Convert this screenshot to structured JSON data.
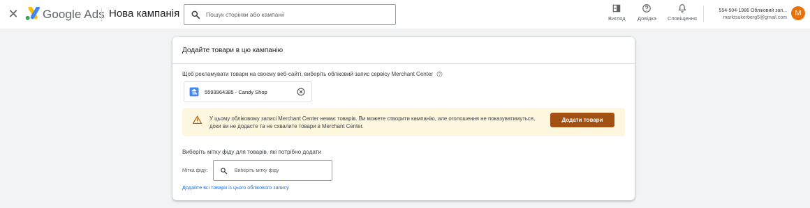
{
  "header": {
    "close_glyph": "✕",
    "brand": "Google Ads",
    "campaign_title": "Нова кампанія",
    "search_placeholder": "Пошук сторінки або кампанії",
    "tools": [
      {
        "icon": "view-icon",
        "label": "Вигляд"
      },
      {
        "icon": "help-icon",
        "label": "Довідка"
      },
      {
        "icon": "bell-icon",
        "label": "Сповіщення"
      }
    ],
    "account": {
      "line1": "554-504-1986 Обліковий зап...",
      "line2": "marktsukerberg5@gmail.com"
    },
    "avatar_letter": "M"
  },
  "card": {
    "title": "Додайте товари в цю кампанію",
    "merchant_prompt": "Щоб рекламувати товари на своєму веб-сайті, виберіть обліковий запис сервісу Merchant Center",
    "merchant_chip": "5593964385 - Candy Shop",
    "warning": {
      "text": "У цьому обліковому записі Merchant Center немає товарів. Ви можете створити кампанію, але оголошення не показуватимуться, доки ви не додасте та не схвалите товари в Merchant Center.",
      "button": "Додати товари"
    },
    "feed_heading": "Виберіть мітку фіду для товарів, які потрібно додати",
    "feed_label": "Мітка фіду:",
    "feed_placeholder": "Виберіть мітку фіду",
    "add_all_link": "Додайте всі товари із цього облікового запису"
  },
  "colors": {
    "accent_blue": "#1a73e8",
    "warning_bg": "#fef7e0",
    "warning_button": "#a35112",
    "avatar_bg": "#e8710a",
    "warning_icon": "#b06000"
  }
}
